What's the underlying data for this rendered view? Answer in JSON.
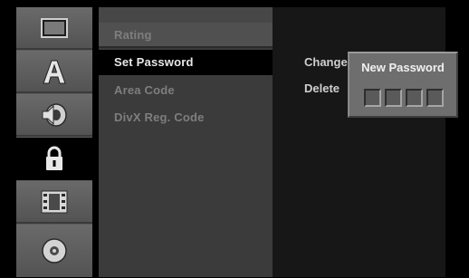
{
  "sidebar": {
    "icons": [
      {
        "name": "tv-screen-icon",
        "selected": false
      },
      {
        "name": "language-letter-a-icon",
        "selected": false
      },
      {
        "name": "speaker-audio-icon",
        "selected": false
      },
      {
        "name": "padlock-icon",
        "selected": true
      },
      {
        "name": "film-strip-icon",
        "selected": false
      },
      {
        "name": "disc-icon",
        "selected": false
      }
    ]
  },
  "menu": {
    "items": [
      {
        "label": "Rating",
        "state": "dimmed"
      },
      {
        "label": "Set Password",
        "state": "selected"
      },
      {
        "label": "Area Code",
        "state": "dimmed"
      },
      {
        "label": "DivX Reg. Code",
        "state": "dimmed"
      }
    ]
  },
  "submenu": {
    "options": [
      {
        "label": "Change"
      },
      {
        "label": "Delete"
      }
    ]
  },
  "popup": {
    "title": "New Password",
    "digit_count": 4,
    "digits": [
      "",
      "",
      "",
      ""
    ]
  },
  "colors": {
    "background": "#000000",
    "sidebar": "#5b5b5b",
    "menu": "#3b3b3b",
    "selected": "#000000",
    "popup": "#6e6e6e"
  }
}
